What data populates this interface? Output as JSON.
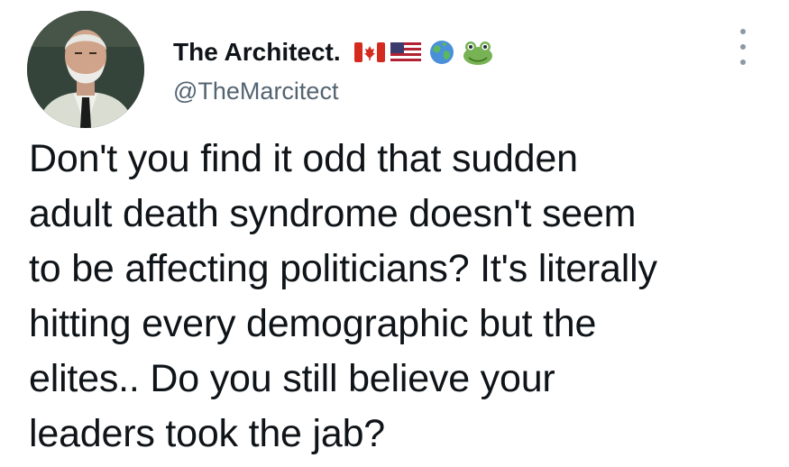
{
  "author": {
    "display_name": "The Architect.",
    "handle": "@TheMarcitect",
    "avatar_icon": "profile-photo-avatar"
  },
  "name_emojis": [
    "canada-flag-icon",
    "us-flag-icon",
    "globe-earth-icon",
    "frog-face-icon"
  ],
  "more_icon": "more-options-dots-icon",
  "tweet": {
    "text": "Don't you find it odd that sudden\nadult death syndrome doesn't seem\nto be affecting politicians? It's literally\nhitting every demographic but the\nelites.. Do you still believe your\nleaders took the jab?"
  },
  "colors": {
    "text": "#0f1419",
    "secondary": "#536471",
    "icon": "#8b98a5",
    "background": "#ffffff"
  }
}
